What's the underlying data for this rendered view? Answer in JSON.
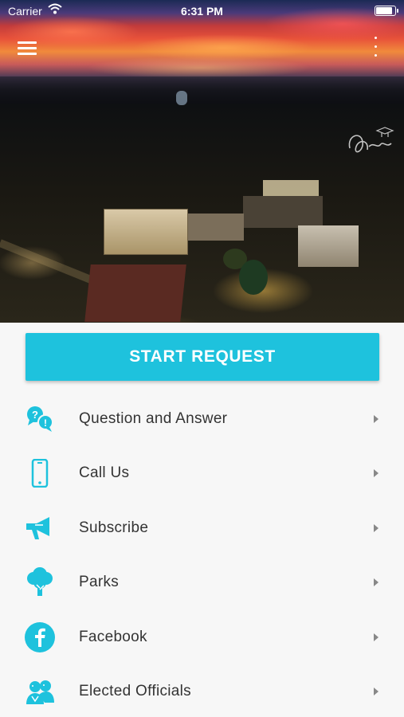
{
  "status_bar": {
    "carrier": "Carrier",
    "time": "6:31 PM",
    "battery_level": 0.9
  },
  "app_bar": {
    "menu_icon": "hamburger-menu-icon",
    "more_icon": "more-vertical-icon"
  },
  "hero": {
    "image": "aerial-town-sunset-photo"
  },
  "start_request": {
    "label": "START REQUEST"
  },
  "menu": [
    {
      "label": "Question and Answer",
      "icon": "question-answer-icon"
    },
    {
      "label": "Call Us",
      "icon": "phone-icon"
    },
    {
      "label": "Subscribe",
      "icon": "megaphone-icon"
    },
    {
      "label": "Parks",
      "icon": "tree-icon"
    },
    {
      "label": "Facebook",
      "icon": "facebook-icon"
    },
    {
      "label": "Elected Officials",
      "icon": "people-icon"
    }
  ],
  "colors": {
    "accent": "#1ec2dd",
    "text": "#333333",
    "chevron": "#888888"
  }
}
